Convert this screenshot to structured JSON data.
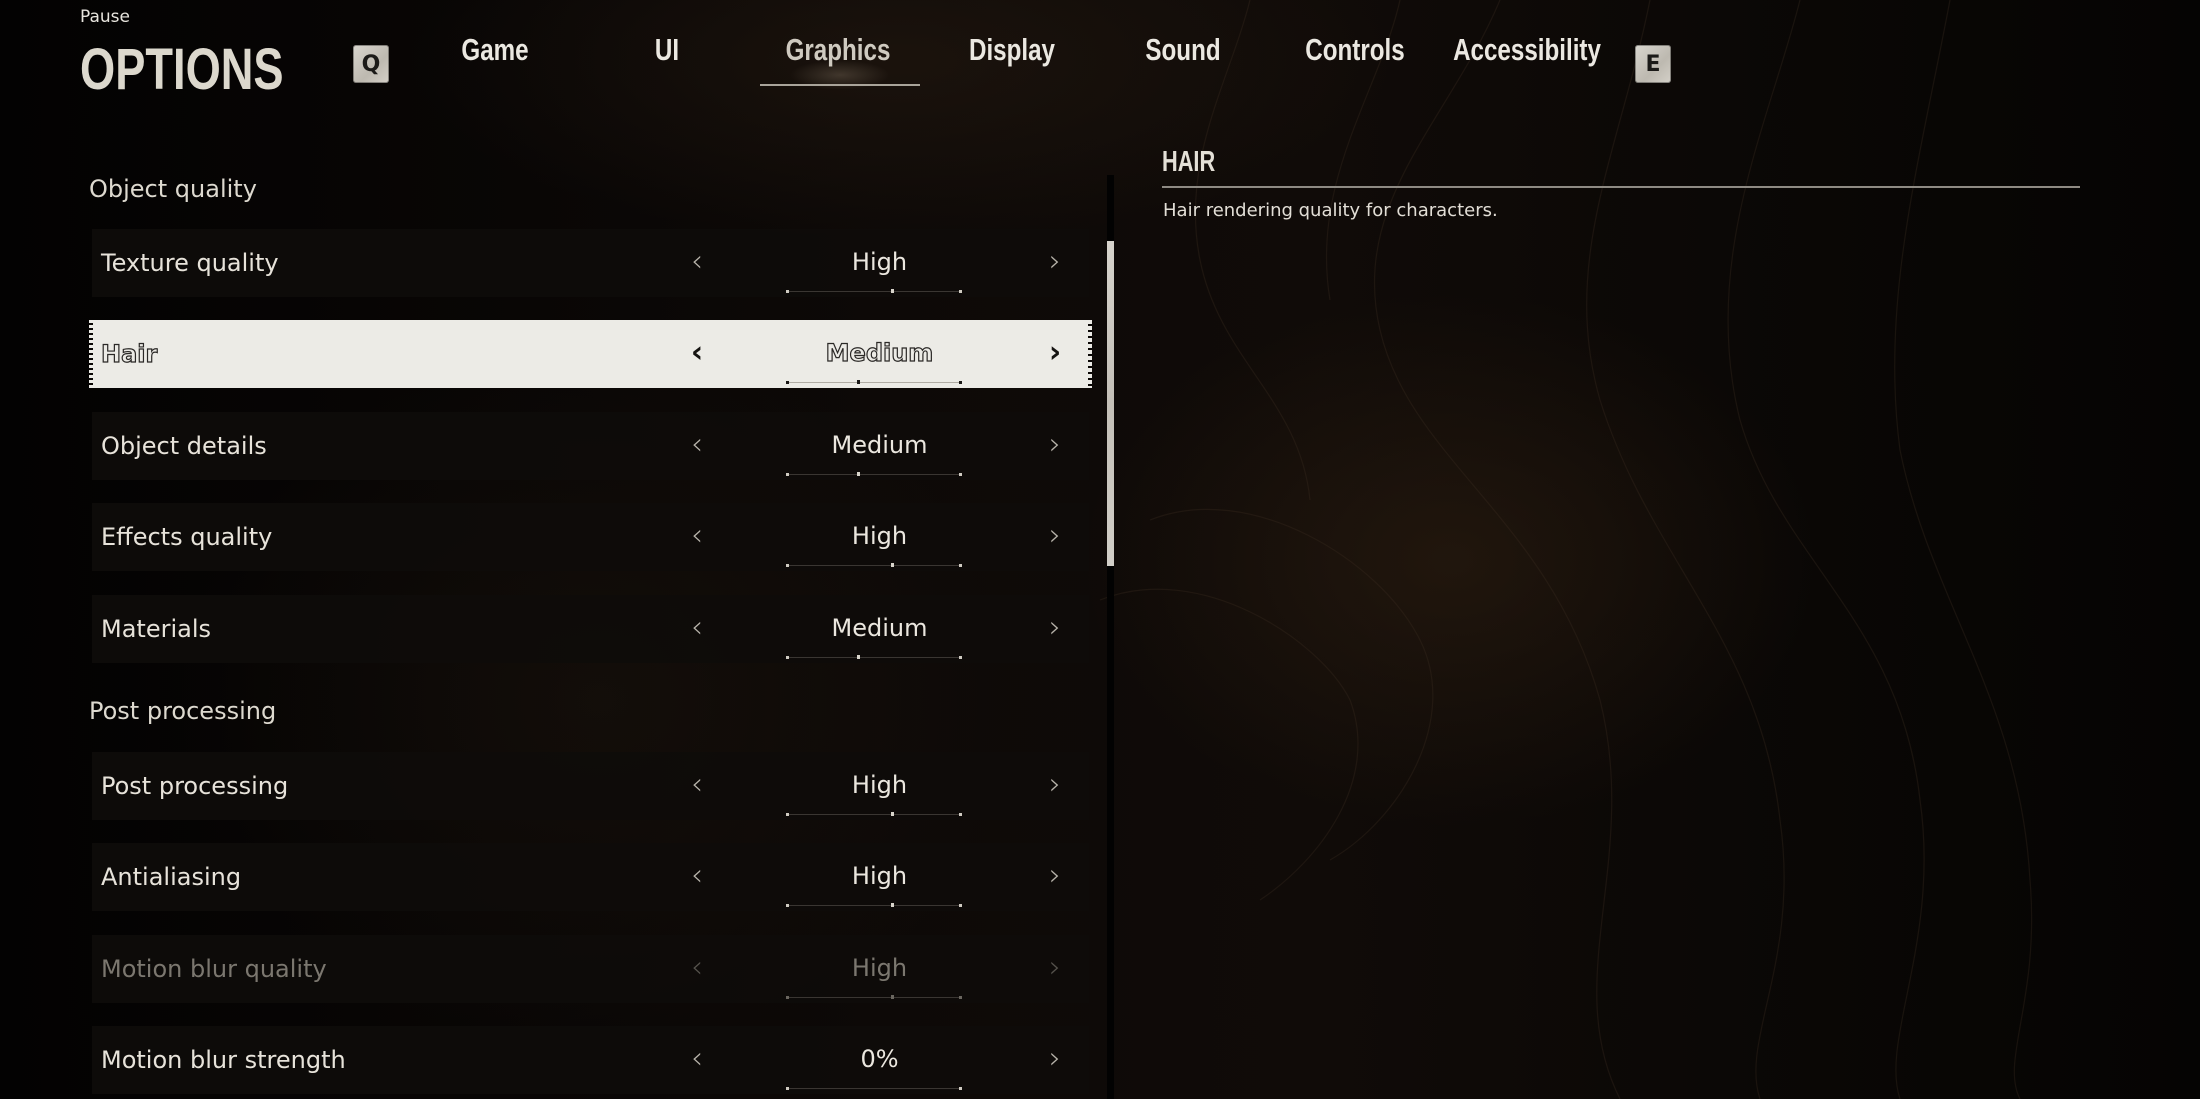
{
  "header": {
    "pause_label": "Pause",
    "title": "OPTIONS",
    "prev_key": "Q",
    "next_key": "E"
  },
  "tabs": [
    {
      "label": "Game",
      "active": false
    },
    {
      "label": "UI",
      "active": false
    },
    {
      "label": "Graphics",
      "active": true
    },
    {
      "label": "Display",
      "active": false
    },
    {
      "label": "Sound",
      "active": false
    },
    {
      "label": "Controls",
      "active": false
    },
    {
      "label": "Accessibility",
      "active": false
    }
  ],
  "sections": [
    {
      "header": "Object quality",
      "settings": [
        {
          "label": "Texture quality",
          "value": "High",
          "level": 0.6,
          "selected": false,
          "disabled": false
        },
        {
          "label": "Hair",
          "value": "Medium",
          "level": 0.4,
          "selected": true,
          "disabled": false
        },
        {
          "label": "Object details",
          "value": "Medium",
          "level": 0.4,
          "selected": false,
          "disabled": false
        },
        {
          "label": "Effects quality",
          "value": "High",
          "level": 0.6,
          "selected": false,
          "disabled": false
        },
        {
          "label": "Materials",
          "value": "Medium",
          "level": 0.4,
          "selected": false,
          "disabled": false
        }
      ]
    },
    {
      "header": "Post processing",
      "settings": [
        {
          "label": "Post processing",
          "value": "High",
          "level": 0.6,
          "selected": false,
          "disabled": false
        },
        {
          "label": "Antialiasing",
          "value": "High",
          "level": 0.6,
          "selected": false,
          "disabled": false
        },
        {
          "label": "Motion blur quality",
          "value": "High",
          "level": 0.6,
          "selected": false,
          "disabled": true
        },
        {
          "label": "Motion blur strength",
          "value": "0%",
          "level": 0.0,
          "selected": false,
          "disabled": false
        }
      ]
    }
  ],
  "icons": {
    "left_arrow": "‹",
    "right_arrow": "›"
  },
  "scrollbar": {
    "position_fraction": 0.07,
    "visible_fraction": 0.35
  },
  "description": {
    "title": "HAIR",
    "text": "Hair rendering quality for characters."
  }
}
